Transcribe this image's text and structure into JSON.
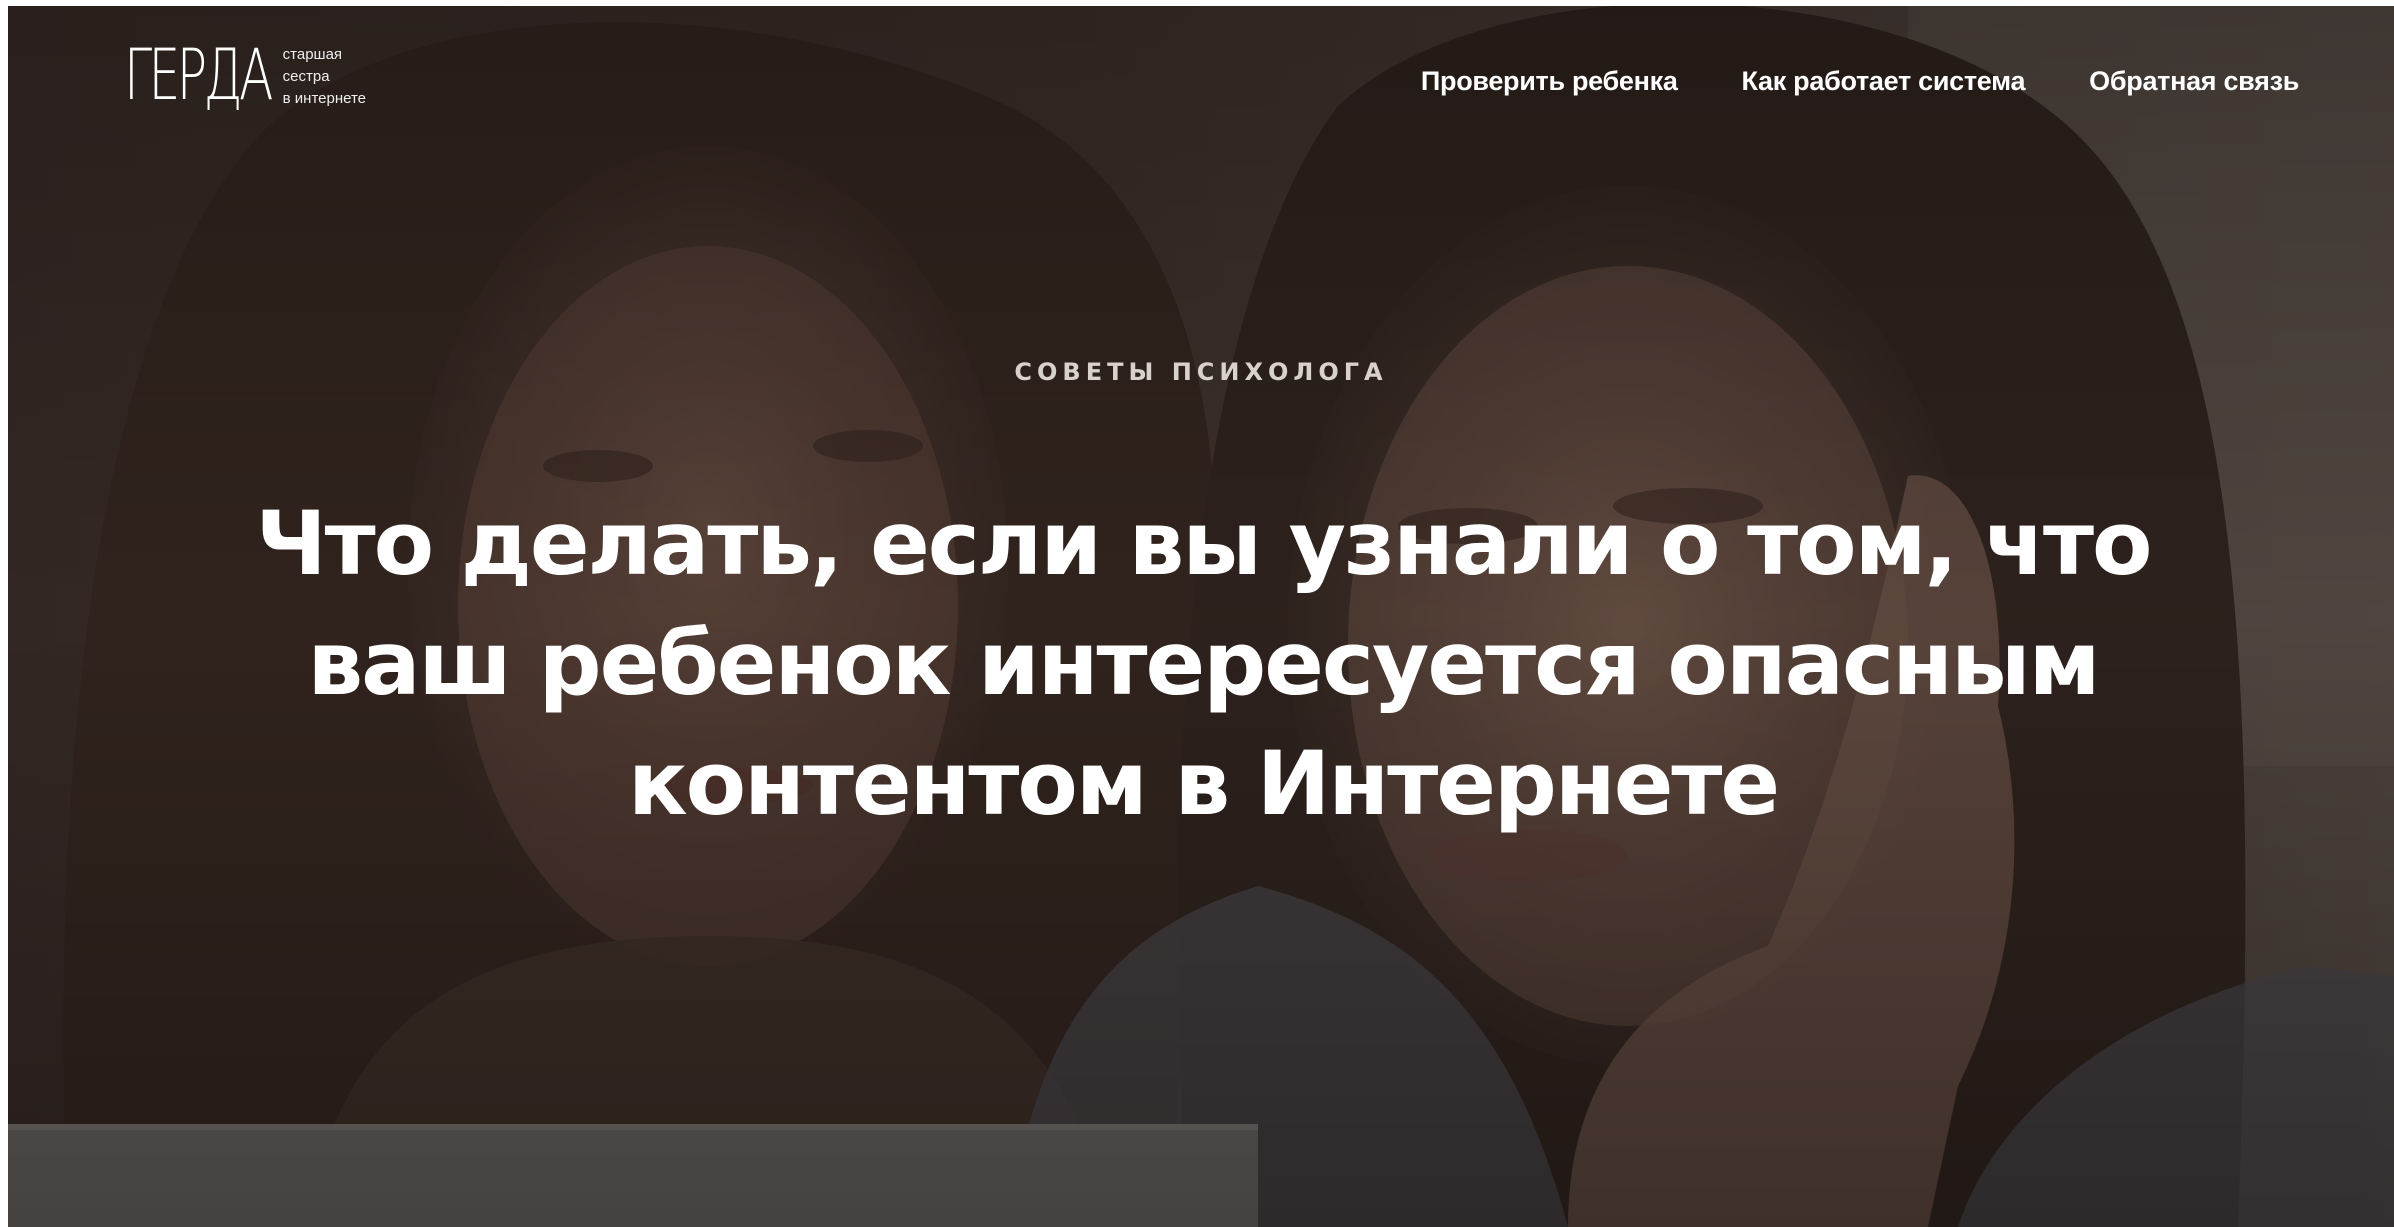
{
  "header": {
    "logo": {
      "wordmark": "ГЕРДА",
      "tagline_lines": [
        "старшая",
        "сестра",
        "в интернете"
      ]
    },
    "nav": [
      {
        "label": "Проверить ребенка"
      },
      {
        "label": "Как работает система"
      },
      {
        "label": "Обратная связь"
      }
    ]
  },
  "hero": {
    "kicker": "СОВЕТЫ ПСИХОЛОГА",
    "title": "Что делать, если вы узнали о том, что ваш ребенок интересуется опасным контентом в Интернете"
  },
  "colors": {
    "overlay": "#2b211d",
    "text": "#ffffff",
    "kicker": "#d9d2cc"
  }
}
